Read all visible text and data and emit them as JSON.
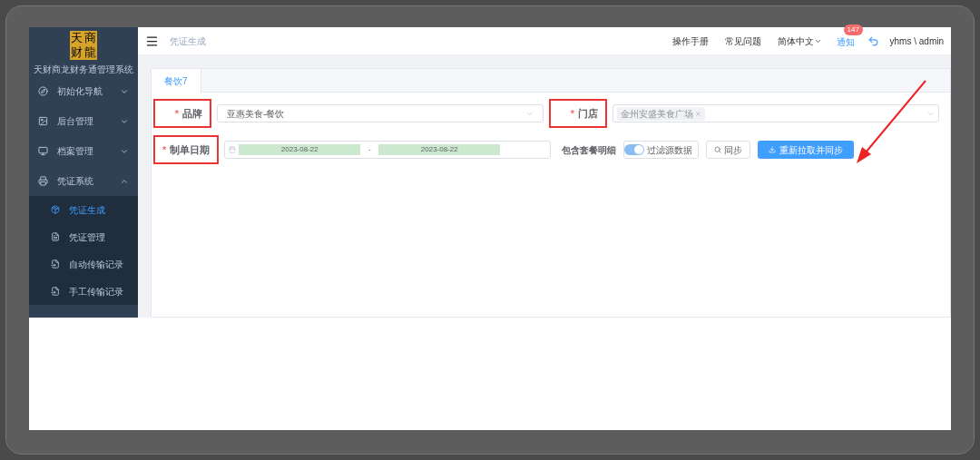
{
  "sidebar": {
    "logo_chars": [
      "天",
      "商",
      "财",
      "龍"
    ],
    "system_name": "天财商龙财务通管理系统",
    "items": [
      {
        "label": "初始化导航",
        "expanded": false
      },
      {
        "label": "后台管理",
        "expanded": false
      },
      {
        "label": "档案管理",
        "expanded": false
      },
      {
        "label": "凭证系统",
        "expanded": true,
        "children": [
          {
            "label": "凭证生成",
            "selected": true
          },
          {
            "label": "凭证管理",
            "selected": false
          },
          {
            "label": "自动传输记录",
            "selected": false
          },
          {
            "label": "手工传输记录",
            "selected": false
          }
        ]
      }
    ]
  },
  "header": {
    "breadcrumb": "凭证生成",
    "links": [
      "操作手册",
      "常见问题"
    ],
    "language": "简体中文",
    "notice": {
      "label": "通知",
      "count": "147"
    },
    "user": "yhms \\ admin"
  },
  "tabs": [
    {
      "label": "餐饮7",
      "selected": true
    }
  ],
  "form": {
    "brand": {
      "label": "品牌",
      "required_mark": "*",
      "highlighted": true,
      "value": "亚惠美食-餐饮"
    },
    "store": {
      "label": "门店",
      "required_mark": "*",
      "highlighted": true,
      "tags": [
        "金州安盛美食广场"
      ]
    },
    "date": {
      "label": "制单日期",
      "required_mark": "*",
      "highlighted": true,
      "start": "2023-08-22",
      "end": "2023-08-22",
      "separator": "-"
    },
    "include_label": "包含套餐明细",
    "filter": {
      "label": "过滤源数据",
      "on": true
    },
    "sync_button": "同步",
    "resync_button": "重新拉取并同步"
  },
  "annotation_arrow": true
}
